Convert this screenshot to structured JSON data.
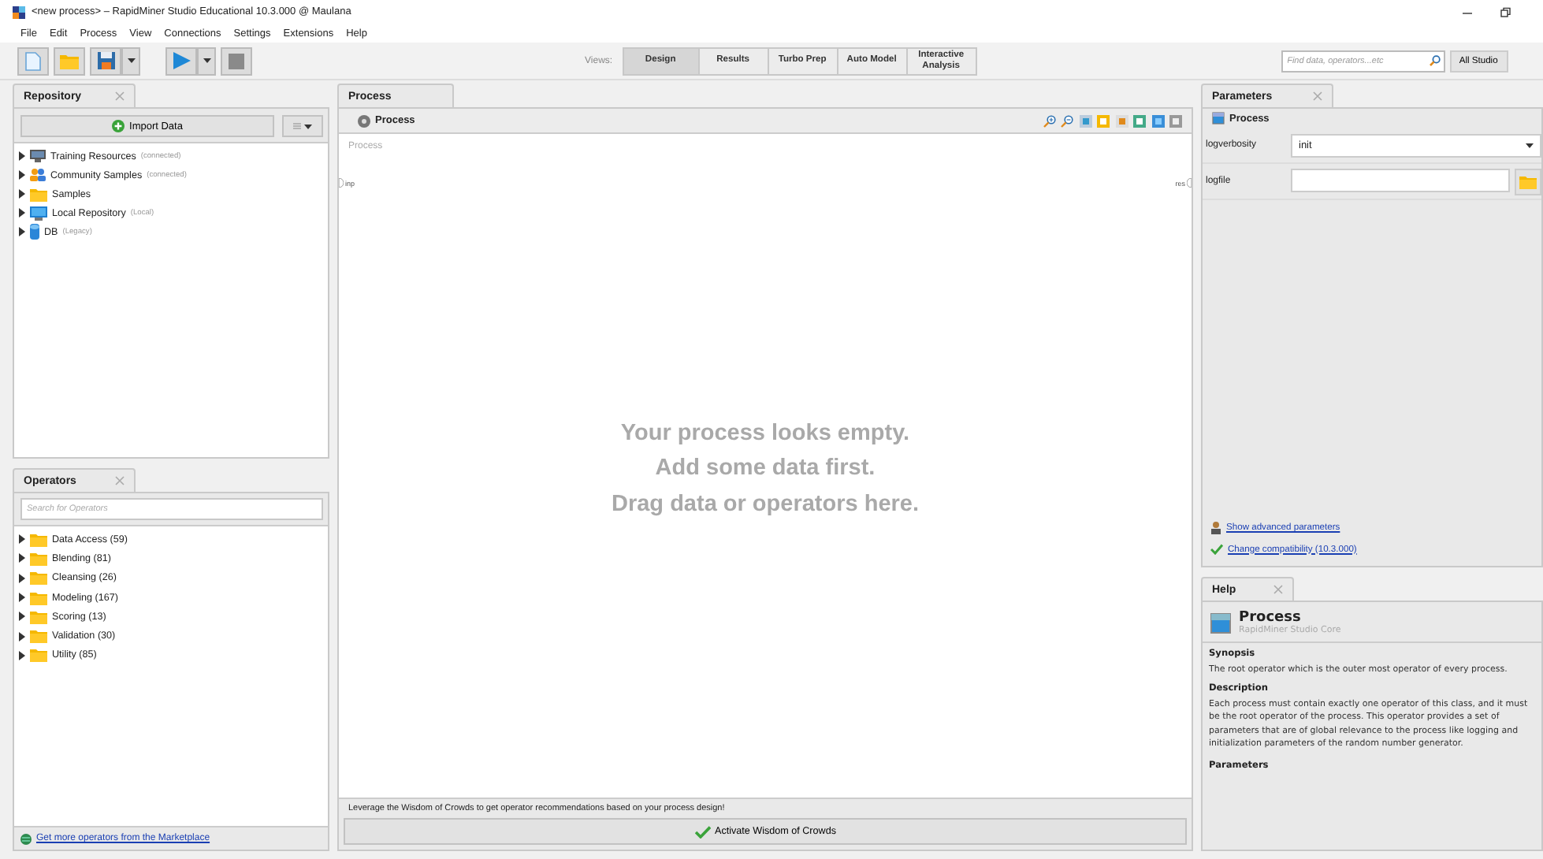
{
  "window": {
    "title": "<new process> – RapidMiner Studio Educational 10.3.000 @ Maulana"
  },
  "menu": [
    "File",
    "Edit",
    "Process",
    "View",
    "Connections",
    "Settings",
    "Extensions",
    "Help"
  ],
  "toolbar": {
    "views_label": "Views:",
    "views": [
      {
        "label": "Design",
        "selected": true
      },
      {
        "label": "Results",
        "selected": false
      },
      {
        "label": "Turbo Prep",
        "selected": false
      },
      {
        "label": "Auto Model",
        "selected": false
      },
      {
        "label": "Interactive Analysis",
        "selected": false
      }
    ],
    "search": {
      "placeholder": "Find data, operators...etc"
    },
    "scope": "All Studio"
  },
  "repository": {
    "tab": "Repository",
    "import_button": "Import Data",
    "items": [
      {
        "kind": "training",
        "name": "Training Resources",
        "note": "(connected)"
      },
      {
        "kind": "community",
        "name": "Community Samples",
        "note": "(connected)"
      },
      {
        "kind": "folder",
        "name": "Samples"
      },
      {
        "kind": "local",
        "name": "Local Repository",
        "note": "(Local)"
      },
      {
        "kind": "db",
        "name": "DB",
        "note": "(Legacy)"
      }
    ]
  },
  "operators": {
    "tab": "Operators",
    "search": {
      "placeholder": "Search for Operators"
    },
    "categories": [
      "Data Access (59)",
      "Blending (81)",
      "Cleansing (26)",
      "Modeling (167)",
      "Scoring (13)",
      "Validation (30)",
      "Utility (85)"
    ],
    "marketplace_link": "Get more operators from the Marketplace"
  },
  "process": {
    "tab": "Process",
    "breadcrumb": "Process",
    "canvas_label": "Process",
    "input_port": "inp",
    "output_port": "res",
    "empty_message": [
      "Your process looks empty.",
      "Add some data first.",
      "Drag data or operators here."
    ],
    "recommendation": "Leverage the Wisdom of Crowds to get operator recommendations based on your process design!",
    "activate_button": "Activate Wisdom of Crowds"
  },
  "parameters": {
    "tab": "Parameters",
    "operator": "Process",
    "fields": [
      {
        "kind": "select",
        "label": "logverbosity",
        "value": "init"
      },
      {
        "kind": "file",
        "label": "logfile"
      }
    ],
    "links": [
      {
        "kind": "advanced",
        "text": "Show advanced parameters"
      },
      {
        "kind": "compatibility",
        "text": "Change compatibility (10.3.000)"
      }
    ]
  },
  "help": {
    "tab": "Help",
    "title": "Process",
    "subtitle": "RapidMiner Studio Core",
    "sections": [
      {
        "heading": "Synopsis",
        "text": "The root operator which is the outer most operator of every process."
      },
      {
        "heading": "Description",
        "text": "Each process must contain exactly one operator of this class, and it must be the root operator of the process. This operator provides a set of parameters that are of global relevance to the process like logging and initialization parameters of the random number generator."
      },
      {
        "heading": "Parameters"
      }
    ]
  }
}
